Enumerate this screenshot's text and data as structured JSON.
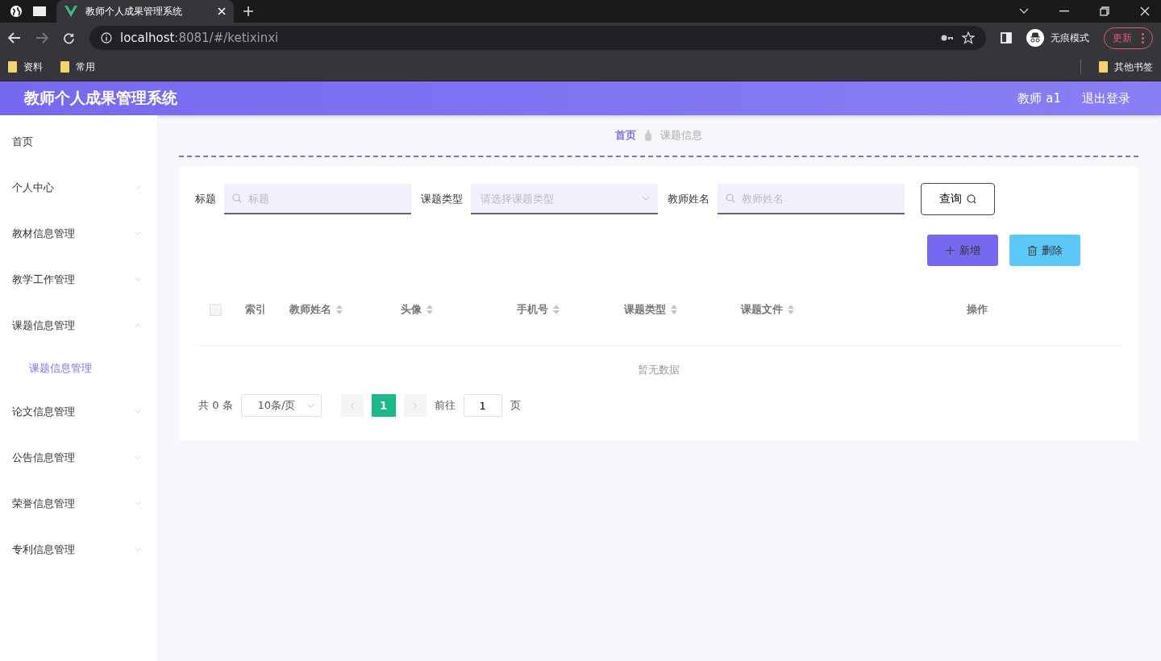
{
  "browser": {
    "tabs": [
      {
        "title": "教师个人成果管理系统",
        "selected": true
      }
    ],
    "url": {
      "host": "localhost",
      "rest": ":8081/#/ketixinxi"
    },
    "incognito_label": "无痕模式",
    "update_button": "更新",
    "bookmarks": [
      "资料",
      "常用"
    ],
    "other_bookmarks": "其他书签"
  },
  "app": {
    "title": "教师个人成果管理系统",
    "user": "教师 a1",
    "logout": "退出登录"
  },
  "sidebar": {
    "items": [
      {
        "label": "首页",
        "selected": false
      },
      {
        "label": "个人中心",
        "expanded": false,
        "selected": false
      },
      {
        "label": "教材信息管理",
        "expanded": false,
        "selected": false
      },
      {
        "label": "教学工作管理",
        "expanded": false,
        "selected": false
      },
      {
        "label": "课题信息管理",
        "expanded": true,
        "selected": false,
        "children": [
          {
            "label": "课题信息管理",
            "selected": true
          }
        ]
      },
      {
        "label": "论文信息管理",
        "expanded": false,
        "selected": false
      },
      {
        "label": "公告信息管理",
        "expanded": false,
        "selected": false
      },
      {
        "label": "荣誉信息管理",
        "expanded": false,
        "selected": false
      },
      {
        "label": "专利信息管理",
        "expanded": false,
        "selected": false
      }
    ]
  },
  "breadcrumb": [
    "首页",
    "课题信息"
  ],
  "search": {
    "fields": [
      {
        "kind": "text",
        "label": "标题",
        "placeholder": "标题"
      },
      {
        "kind": "select",
        "label": "课题类型",
        "placeholder": "请选择课题类型"
      },
      {
        "kind": "text",
        "label": "教师姓名",
        "placeholder": "教师姓名"
      }
    ],
    "query_button": "查询"
  },
  "actions": {
    "add": "新增",
    "delete": "删除"
  },
  "table": {
    "select_all_checked": false,
    "columns": [
      {
        "label": "索引",
        "sortable": false
      },
      {
        "label": "教师姓名",
        "sortable": true
      },
      {
        "label": "头像",
        "sortable": true
      },
      {
        "label": "手机号",
        "sortable": true
      },
      {
        "label": "课题类型",
        "sortable": true
      },
      {
        "label": "课题文件",
        "sortable": true
      },
      {
        "label": "操作",
        "sortable": false
      }
    ],
    "empty_text": "暂无数据"
  },
  "pagination": {
    "total": "共 0 条",
    "page_size": "10条/页",
    "pages": [
      {
        "label": "1",
        "selected": true
      }
    ],
    "goto_label": "前往",
    "goto_value": "1",
    "page_unit": "页"
  }
}
